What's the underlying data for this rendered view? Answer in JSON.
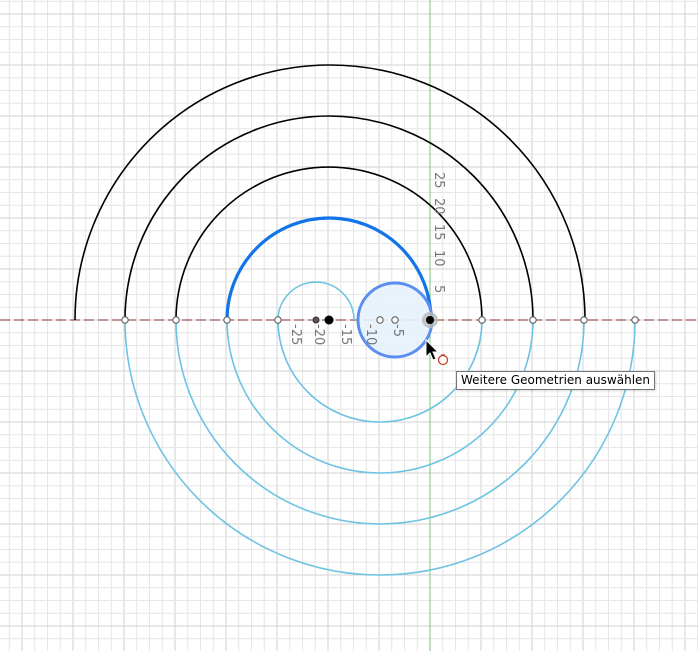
{
  "sketch": {
    "axis_labels": {
      "x_negative": [
        "-25",
        "-20",
        "-15",
        "-10",
        "-5"
      ],
      "y_positive": [
        "25",
        "20",
        "15",
        "10",
        "5"
      ]
    },
    "colors": {
      "grid_minor": "#e6e6e6",
      "grid_major": "#d2d2d2",
      "x_axis": "#8b2b2b",
      "y_axis": "#7cc47c",
      "fully_defined_curve": "#000000",
      "under_defined_curve": "#6ec3e3",
      "selected_curve": "#1274e8",
      "hover_circle_fill": "#e6f2fb",
      "hover_circle_stroke": "#5b8ef0"
    }
  },
  "cursor": {
    "icon": "arrow-pointer-icon",
    "badge": "select-more-badge-icon"
  },
  "tooltip": {
    "text": "Weitere Geometrien auswählen"
  }
}
